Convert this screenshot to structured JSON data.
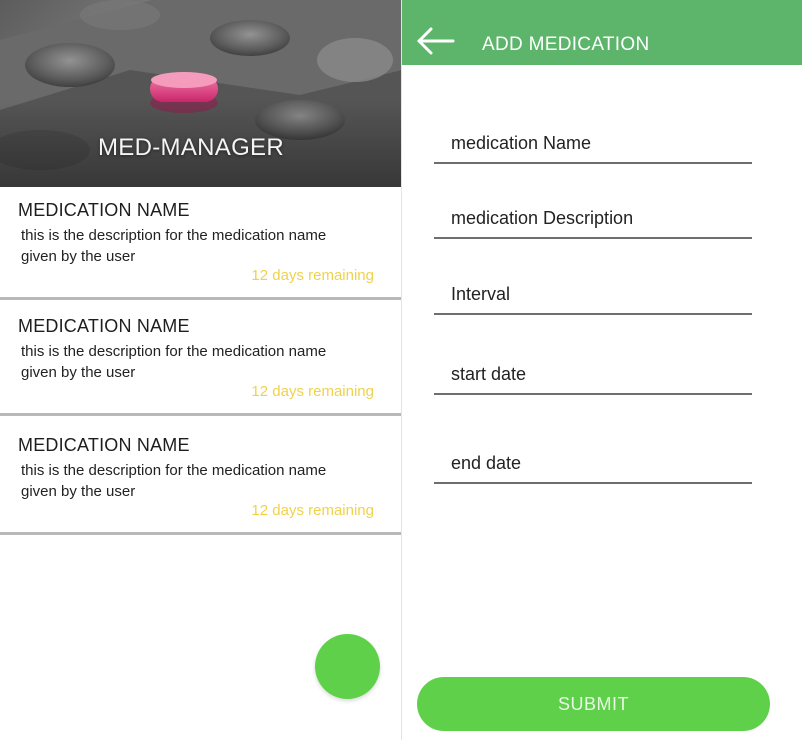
{
  "list_screen": {
    "header_title": "MED-MANAGER",
    "medications": [
      {
        "name": "MEDICATION NAME",
        "description": "this is the description for the medication name given by the user",
        "remaining": "12 days remaining"
      },
      {
        "name": "MEDICATION NAME",
        "description": "this is the description for the medication name given by the user",
        "remaining": "12 days remaining"
      },
      {
        "name": "MEDICATION NAME",
        "description": "this is the description for the medication name given by the user",
        "remaining": "12 days remaining"
      }
    ],
    "fab_icon": "add-icon"
  },
  "add_screen": {
    "title": "ADD MEDICATION",
    "back_icon": "arrow-left-icon",
    "fields": {
      "medication_name_placeholder": "medication Name",
      "medication_description_placeholder": "medication Description",
      "interval_placeholder": "Interval",
      "start_date_placeholder": "start date",
      "end_date_placeholder": "end date"
    },
    "submit_label": "SUBMIT"
  },
  "colors": {
    "toolbar_green": "#5cb56b",
    "button_green": "#5ed04a",
    "remaining_yellow": "#f0d24a",
    "pill_pink": "#e2417f"
  }
}
